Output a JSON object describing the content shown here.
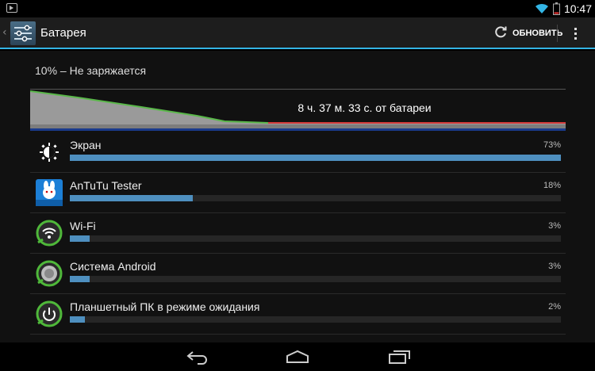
{
  "status_bar": {
    "time": "10:47",
    "icons": [
      "notification-icon",
      "wifi-icon",
      "battery-icon"
    ]
  },
  "action_bar": {
    "title": "Батарея",
    "refresh_label": "ОБНОВИТЬ",
    "icons": [
      "settings-sliders-icon",
      "refresh-icon",
      "overflow-menu-icon"
    ]
  },
  "battery": {
    "summary": "10% – Не заряжается",
    "graph_label": "8 ч. 37 м. 33 с. от батареи",
    "level_start_percent": 100,
    "level_end_percent": 10
  },
  "usage": [
    {
      "name": "Экран",
      "percent": "73%",
      "fraction": 1.0,
      "icon": "brightness-icon"
    },
    {
      "name": "AnTuTu Tester",
      "percent": "18%",
      "fraction": 0.25,
      "icon": "antutu-app-icon"
    },
    {
      "name": "Wi-Fi",
      "percent": "3%",
      "fraction": 0.04,
      "icon": "wifi-icon"
    },
    {
      "name": "Система Android",
      "percent": "3%",
      "fraction": 0.04,
      "icon": "android-system-icon"
    },
    {
      "name": "Планшетный ПК в режиме ожидания",
      "percent": "2%",
      "fraction": 0.03,
      "icon": "power-icon"
    }
  ],
  "colors": {
    "accent": "#33b5e5",
    "bar_fill": "#4e8fbf",
    "graph_line": "#5ab84a",
    "graph_low": "#d43a3a"
  },
  "nav": {
    "icons": [
      "back-icon",
      "home-icon",
      "recent-apps-icon"
    ]
  }
}
